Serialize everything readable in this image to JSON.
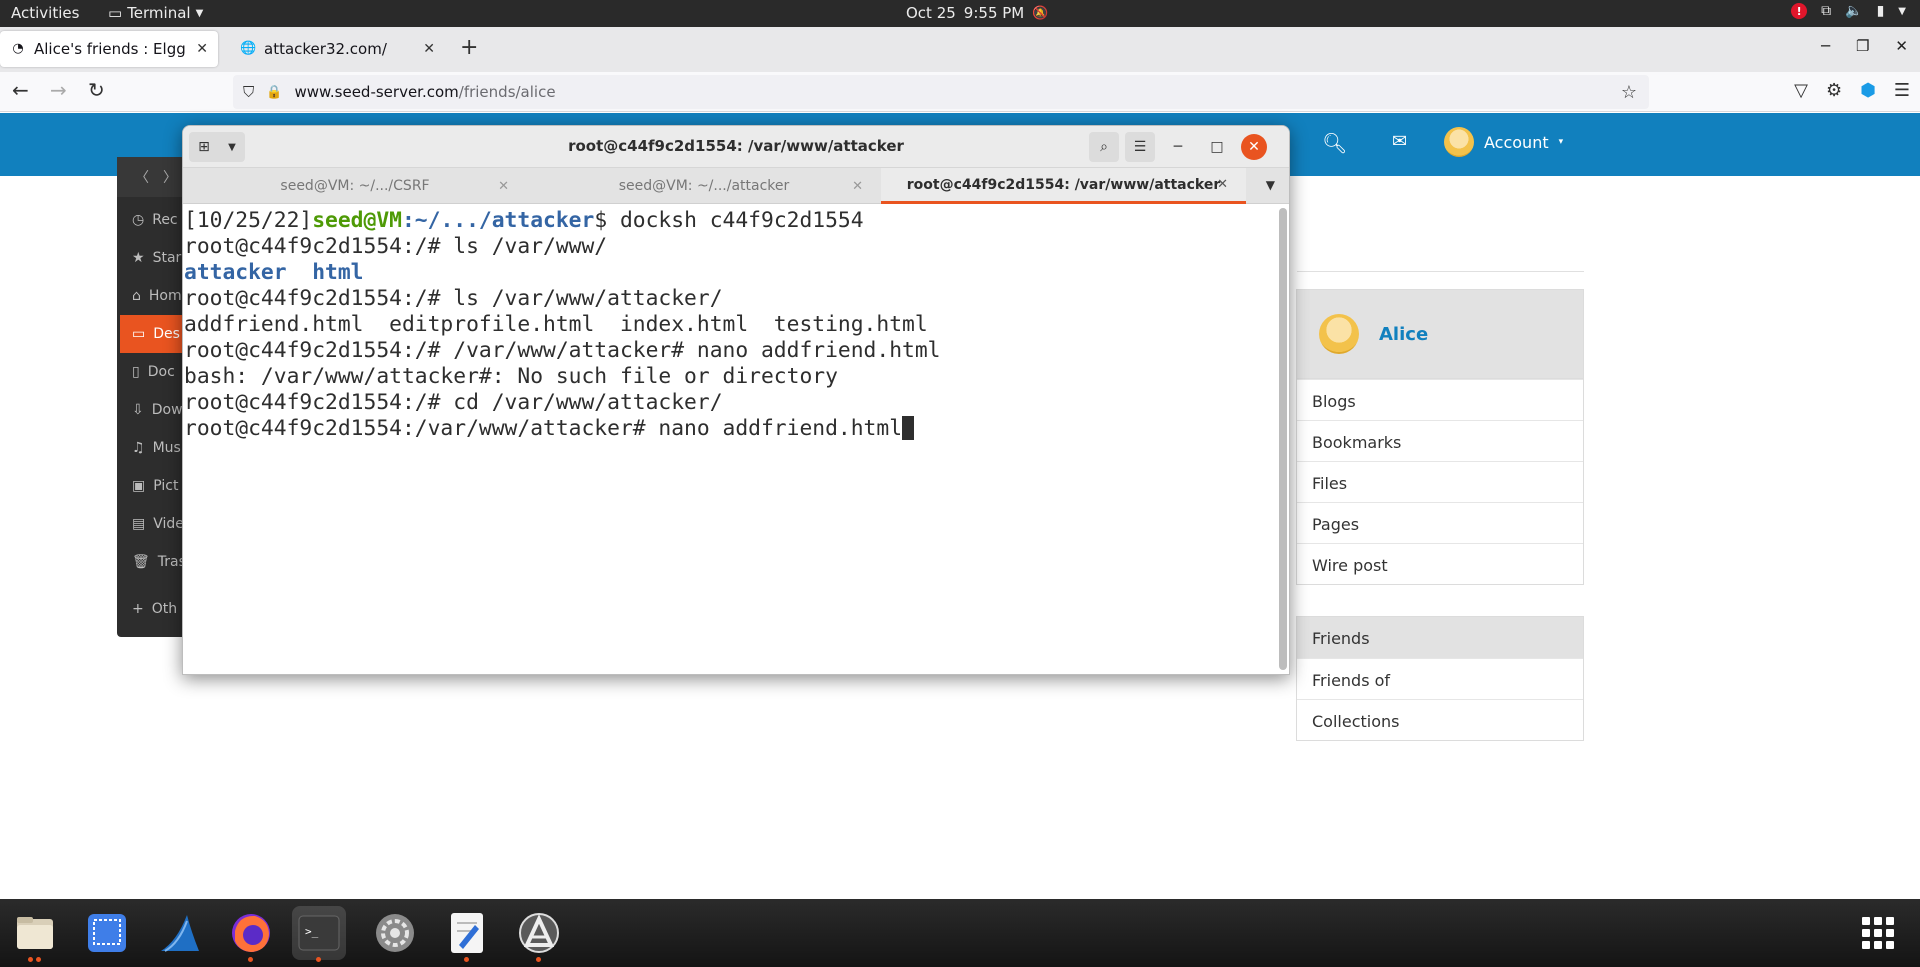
{
  "topbar": {
    "activities": "Activities",
    "app_name": "Terminal",
    "date": "Oct 25",
    "time": "9:55 PM",
    "tray_badge": "!"
  },
  "browser": {
    "tabs": [
      {
        "title": "Alice's friends : Elgg For S"
      },
      {
        "title": "attacker32.com/"
      }
    ],
    "url_host": "www.seed-server.com",
    "url_path": "/friends/alice"
  },
  "elgg": {
    "account_label": "Account",
    "owner_name": "Alice",
    "owner_menu": [
      "Blogs",
      "Bookmarks",
      "Files",
      "Pages",
      "Wire post"
    ],
    "friends_menu": [
      "Friends",
      "Friends of",
      "Collections"
    ]
  },
  "files_sidebar": {
    "items": [
      "Rec",
      "Star",
      "Hom",
      "Des",
      "Doc",
      "Dow",
      "Mus",
      "Pict",
      "Vide",
      "Tras",
      "Oth"
    ]
  },
  "terminal": {
    "title": "root@c44f9c2d1554: /var/www/attacker",
    "tabs": [
      {
        "label": "seed@VM: ~/.../CSRF"
      },
      {
        "label": "seed@VM: ~/.../attacker"
      },
      {
        "label": "root@c44f9c2d1554: /var/www/attacker"
      }
    ],
    "lines": {
      "l1_prefix": "[10/25/22]",
      "l1_user": "seed@VM",
      "l1_path": ":~/.../attacker",
      "l1_cmd": "$ docksh c44f9c2d1554",
      "l2": "root@c44f9c2d1554:/# ls /var/www/",
      "l3": "attacker  html",
      "l4": "root@c44f9c2d1554:/# ls /var/www/attacker/",
      "l5": "addfriend.html  editprofile.html  index.html  testing.html",
      "l6": "root@c44f9c2d1554:/# /var/www/attacker# nano addfriend.html",
      "l7": "bash: /var/www/attacker#: No such file or directory",
      "l8": "root@c44f9c2d1554:/# cd /var/www/attacker/",
      "l9": "root@c44f9c2d1554:/var/www/attacker# nano addfriend.html"
    }
  },
  "colors": {
    "elgg_blue": "#1180be",
    "ubuntu_orange": "#e95420",
    "prompt_green": "#4e9a06",
    "dir_blue": "#3465a4"
  }
}
